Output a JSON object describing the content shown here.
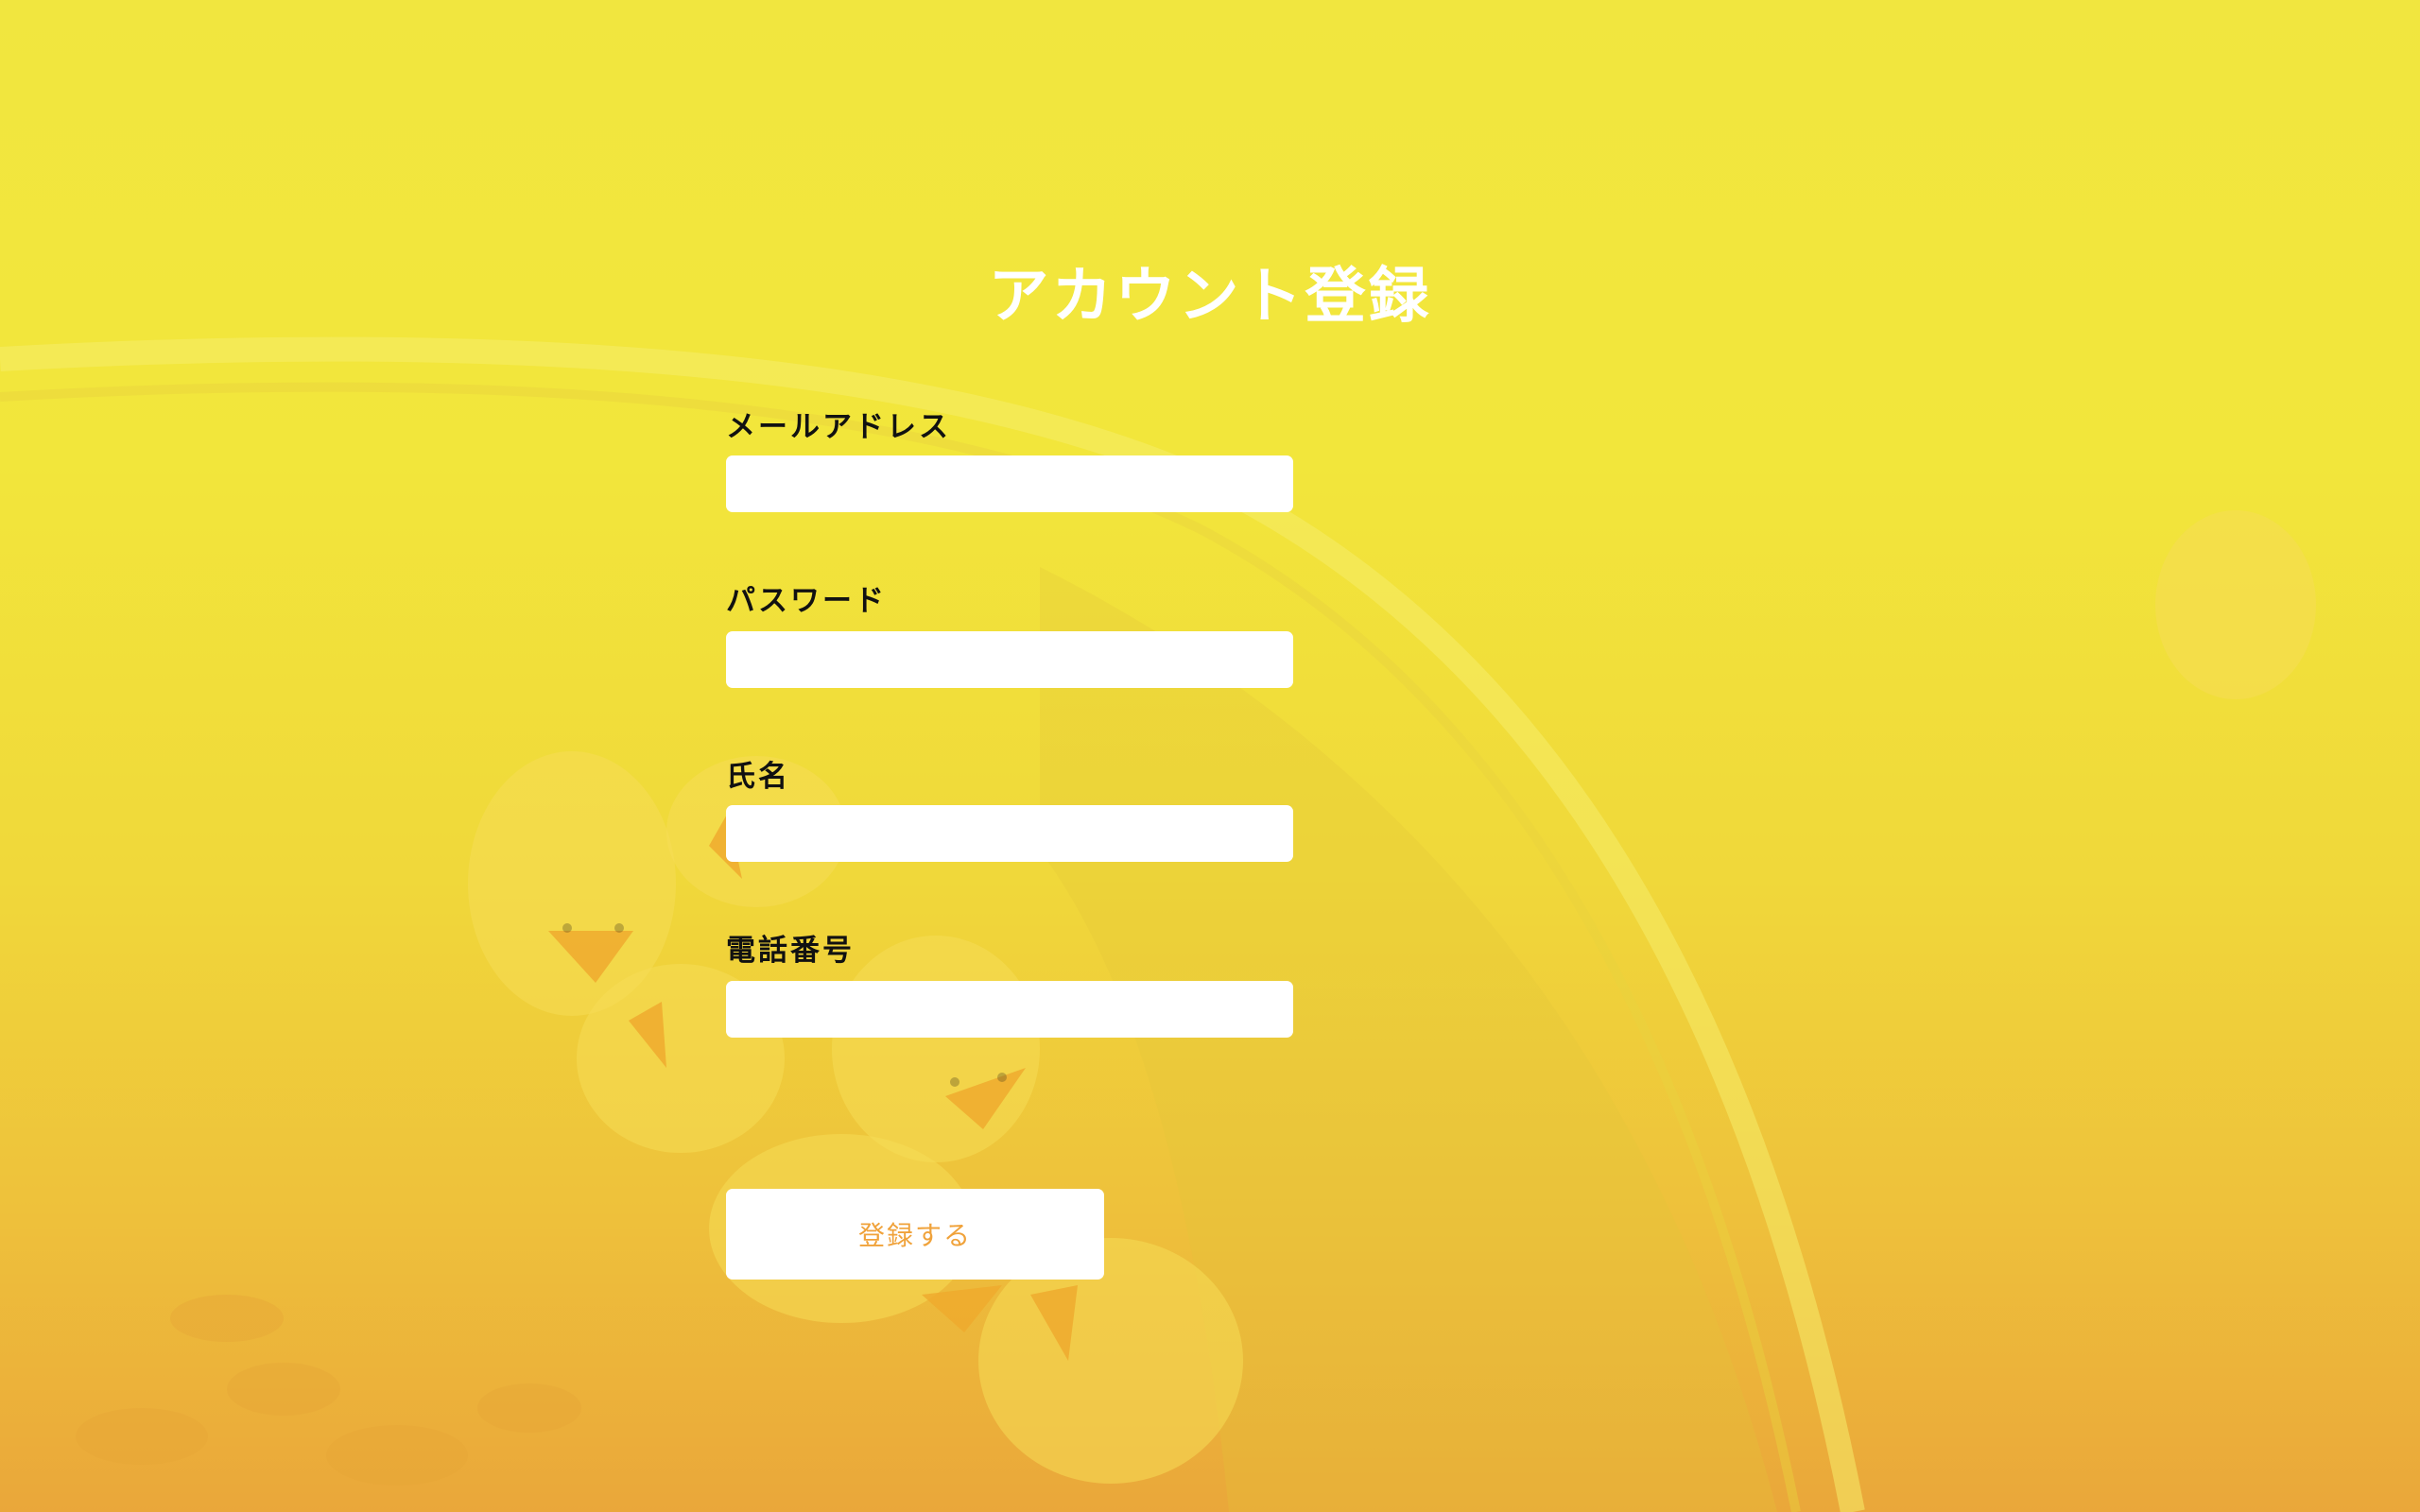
{
  "page": {
    "title": "アカウント登録"
  },
  "form": {
    "fields": [
      {
        "label": "メールアドレス",
        "value": "",
        "placeholder": ""
      },
      {
        "label": "パスワード",
        "value": "",
        "placeholder": ""
      },
      {
        "label": "氏名",
        "value": "",
        "placeholder": ""
      },
      {
        "label": "電話番号",
        "value": "",
        "placeholder": ""
      }
    ],
    "submit_label": "登録する"
  },
  "colors": {
    "background_top": "#f1e63f",
    "background_bottom": "#eaa73a",
    "title": "#ffffff",
    "label": "#111111",
    "button_text": "#f0a23a",
    "input_bg": "#ffffff"
  },
  "background_image": "rubber-ducks-in-bucket"
}
